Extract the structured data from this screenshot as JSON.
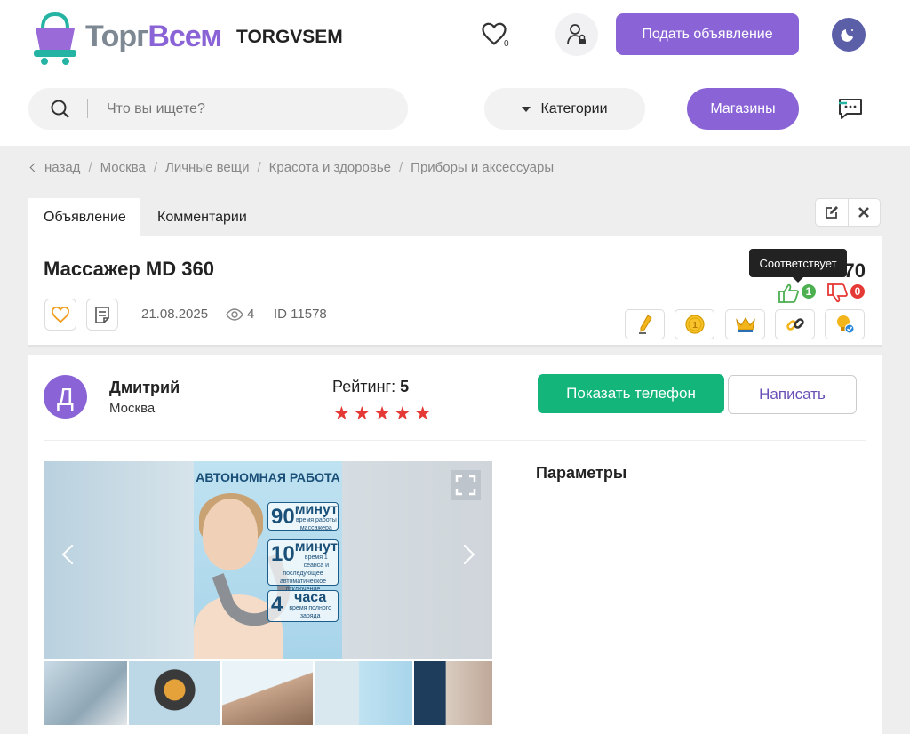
{
  "header": {
    "logo_text_part1": "Торг",
    "logo_text_part2": "Всем",
    "brand_name": "TORGVSEM",
    "favorites_count": "0",
    "post_ad_label": "Подать объявление"
  },
  "search": {
    "placeholder": "Что вы ищете?",
    "categories_label": "Категории",
    "shops_label": "Магазины"
  },
  "breadcrumb": {
    "back": "назад",
    "items": [
      "Москва",
      "Личные вещи",
      "Красота и здоровье",
      "Приборы и аксессуары"
    ]
  },
  "tabs": {
    "ad": "Объявление",
    "comments": "Комментарии"
  },
  "listing": {
    "title": "Массажер MD 360",
    "price": "2 770",
    "price_visible_suffix": "70",
    "tooltip": "Соответствует",
    "likes": "1",
    "dislikes": "0",
    "date": "21.08.2025",
    "views": "4",
    "id_label": "ID 11578"
  },
  "seller": {
    "initial": "Д",
    "name": "Дмитрий",
    "city": "Москва",
    "rating_label": "Рейтинг:",
    "rating_value": "5",
    "rating_stars": 5,
    "stars": "★★★★★",
    "show_phone": "Показать телефон",
    "write": "Написать"
  },
  "gallery": {
    "poster_title": "АВТОНОМНАЯ РАБОТА",
    "box1_num": "90",
    "box1_unit": "минут",
    "box1_text": "время работы массажера",
    "box2_num": "10",
    "box2_unit": "минут",
    "box2_text": "время 1 сеанса и последующее автоматическое отключение",
    "box3_num": "4",
    "box3_unit": "часа",
    "box3_text": "время полного заряда"
  },
  "params": {
    "title": "Параметры"
  },
  "colors": {
    "accent": "#8a64d6",
    "green": "#13b57b",
    "red": "#e53935"
  }
}
